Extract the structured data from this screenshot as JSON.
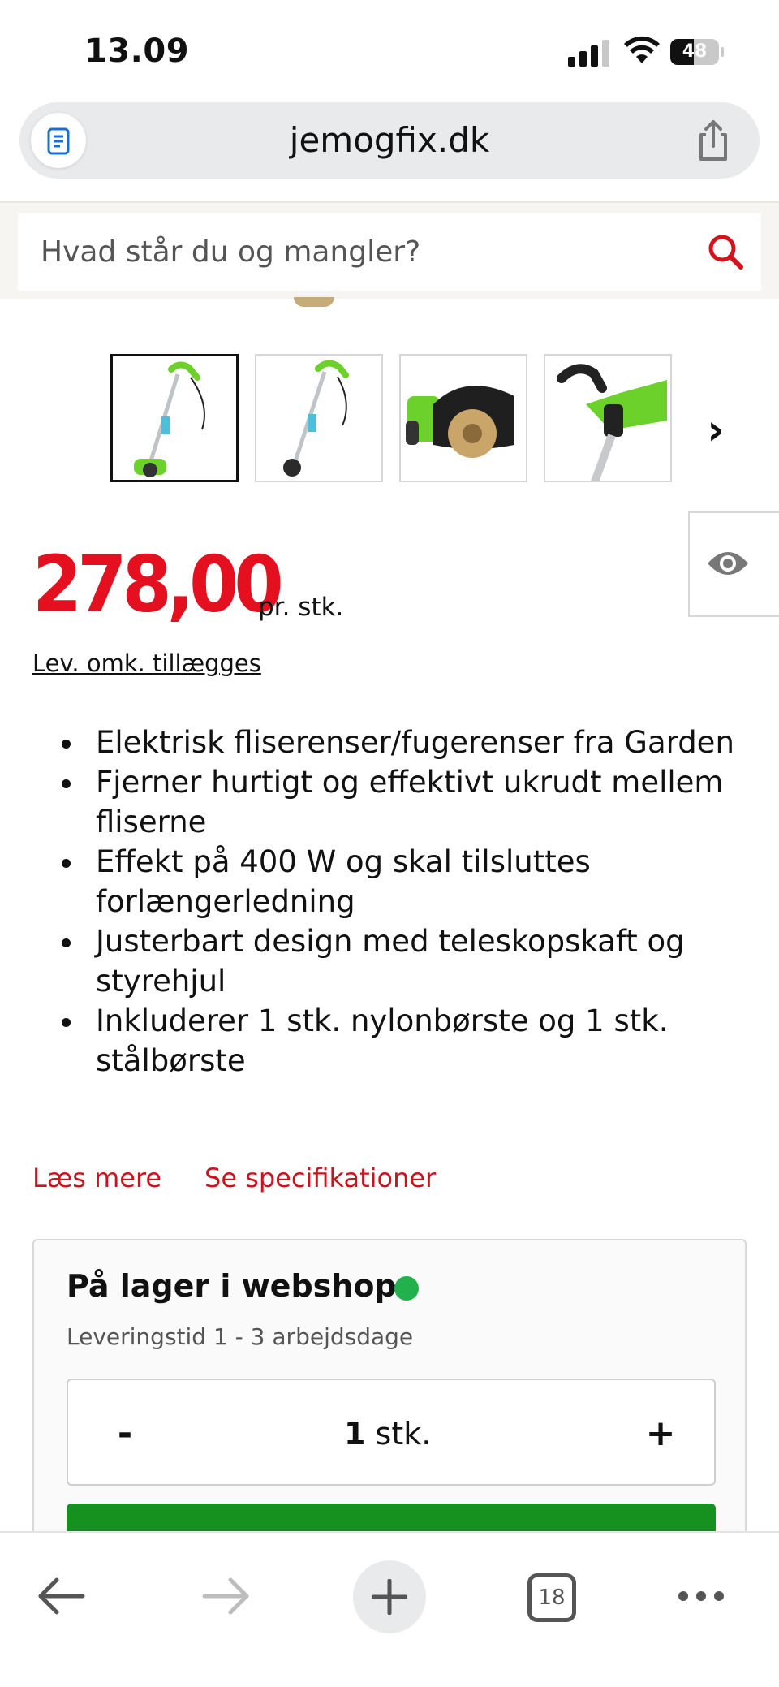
{
  "status_bar": {
    "time": "13.09",
    "battery_percent": "48",
    "battery_level": 0.48
  },
  "browser": {
    "url": "jemogfix.dk",
    "open_tabs": "18"
  },
  "search": {
    "placeholder": "Hvad står du og mangler?"
  },
  "gallery": {
    "thumbnails": [
      {
        "alt": "Fliserenser hele produktet",
        "active": true
      },
      {
        "alt": "Fliserenser skrå vinkel",
        "active": false
      },
      {
        "alt": "Stålbørste nærbillede",
        "active": false
      },
      {
        "alt": "Håndtag nærbillede",
        "active": false
      }
    ],
    "next_label": "›"
  },
  "product": {
    "price": "278,00",
    "unit": "pr. stk.",
    "shipping_note": "Lev. omk. tillægges",
    "features": [
      "Elektrisk fliserenser/fugerenser fra Garden",
      "Fjerner hurtigt og effektivt ukrudt mellem fliserne",
      "Effekt på 400 W og skal tilsluttes forlængerledning",
      "Justerbart design med teleskopskaft og styrehjul",
      "Inkluderer 1 stk. nylonbørste og 1 stk. stålbørste"
    ],
    "read_more": "Læs mere",
    "see_specs": "Se specifikationer"
  },
  "stock": {
    "title": "På lager i webshop",
    "status_color": "#22b14c",
    "delivery": "Leveringstid 1 - 3 arbejdsdage",
    "quantity": {
      "minus": "-",
      "value": "1",
      "unit": "stk.",
      "plus": "+"
    }
  },
  "colors": {
    "brand_red": "#e4101f",
    "link_red": "#c9141d",
    "buy_green": "#16911f"
  }
}
